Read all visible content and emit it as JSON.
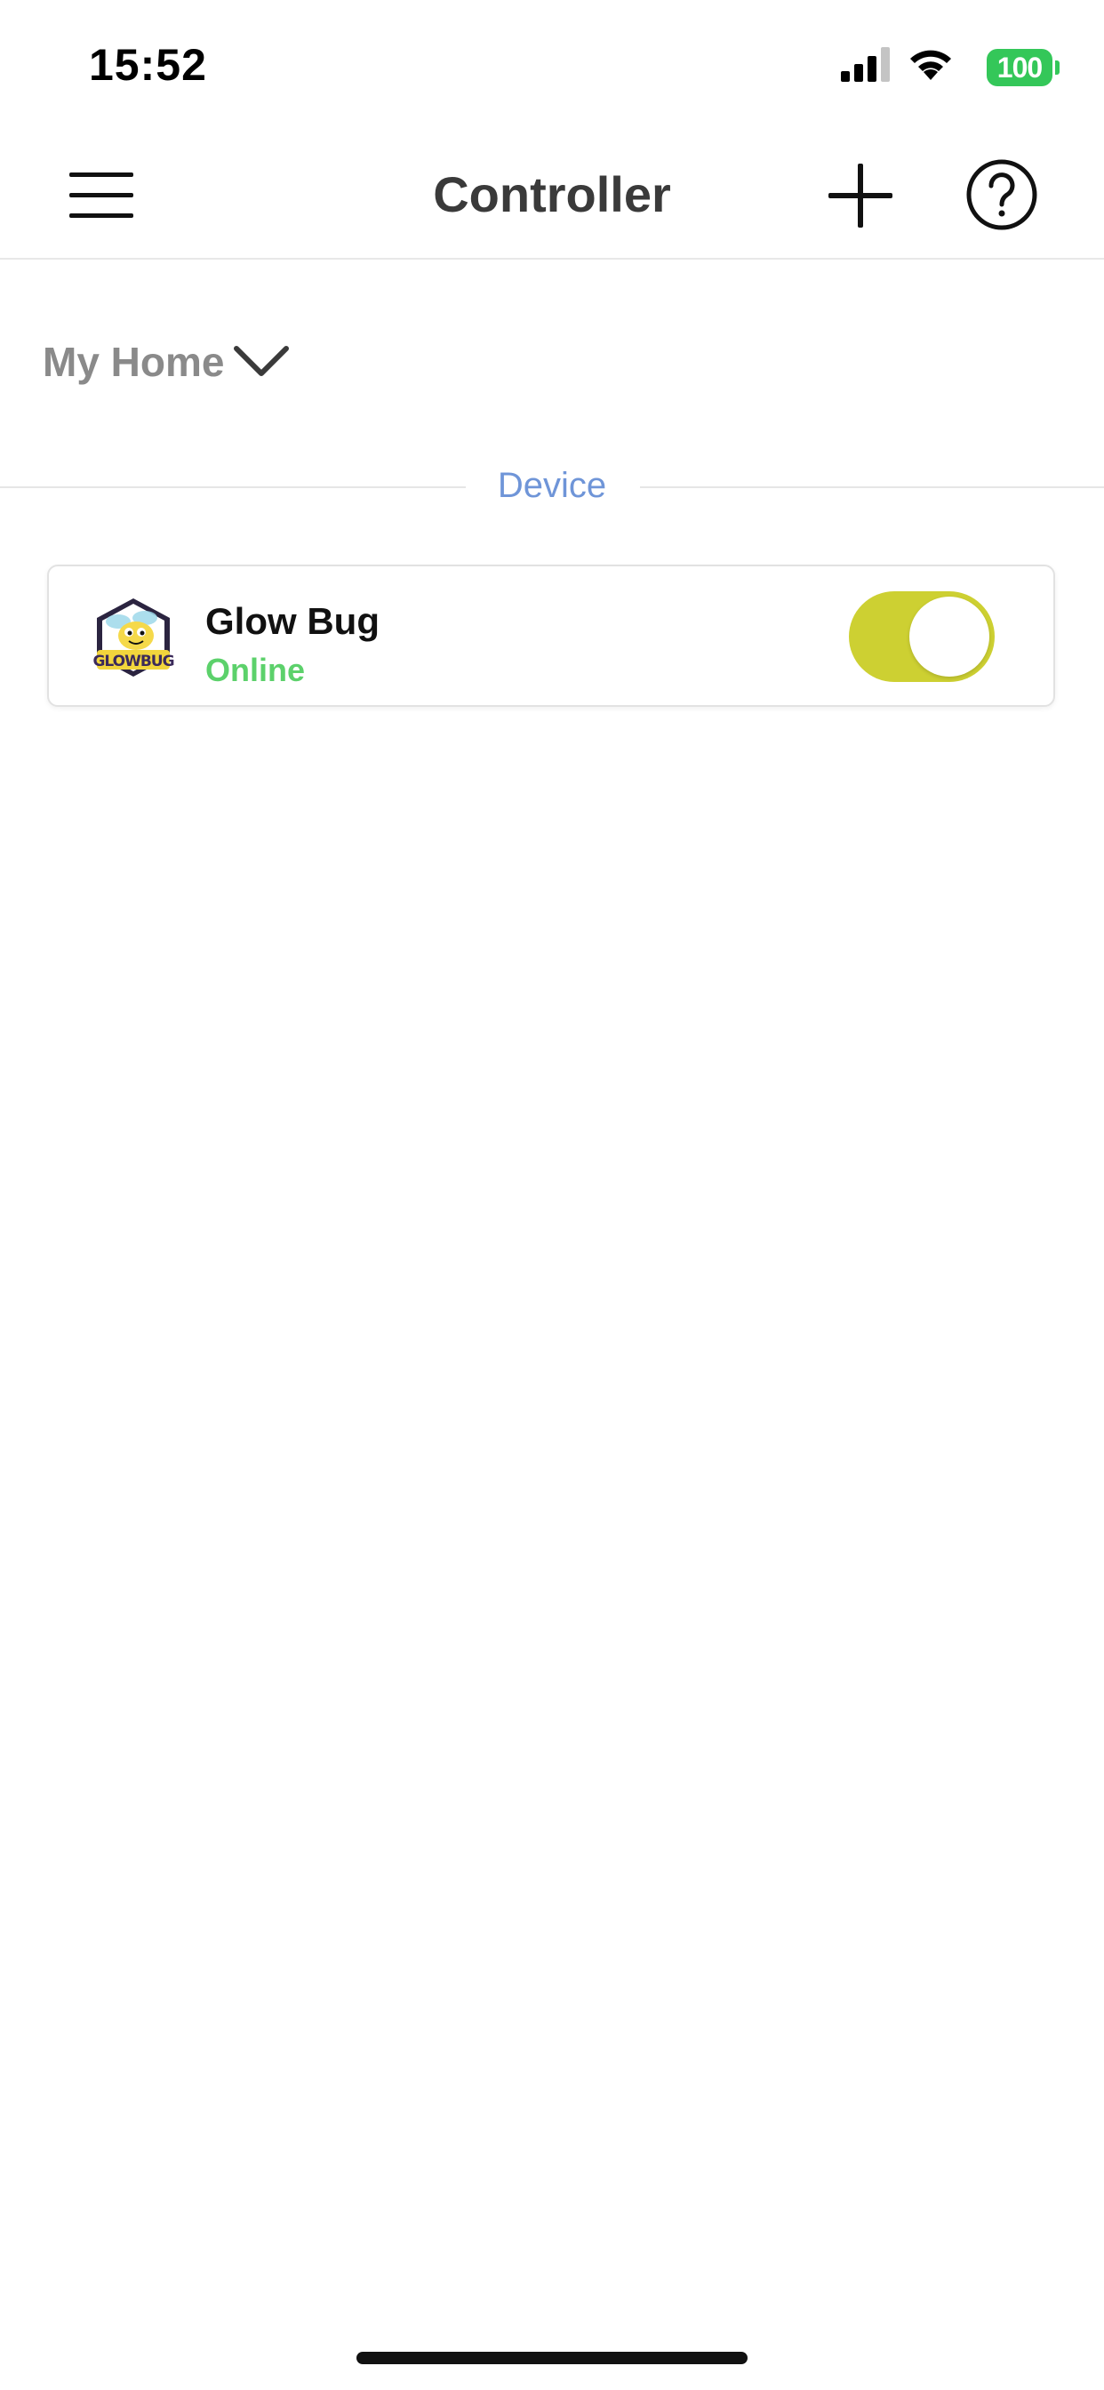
{
  "status_bar": {
    "time": "15:52",
    "battery_level": "100",
    "battery_color": "#34c759"
  },
  "nav": {
    "title": "Controller",
    "menu_icon": "hamburger-menu-icon",
    "add_icon": "plus-icon",
    "help_icon": "question-circle-icon"
  },
  "home_selector": {
    "label": "My Home",
    "icon": "chevron-down-icon"
  },
  "section": {
    "label": "Device",
    "label_color": "#6f95d8"
  },
  "devices": [
    {
      "name": "Glow Bug",
      "status": "Online",
      "status_color": "#5cd16b",
      "logo": "glow-bug-logo",
      "logo_text": "GLOWBUG",
      "toggle_on": true,
      "toggle_color": "#cdd032"
    }
  ]
}
